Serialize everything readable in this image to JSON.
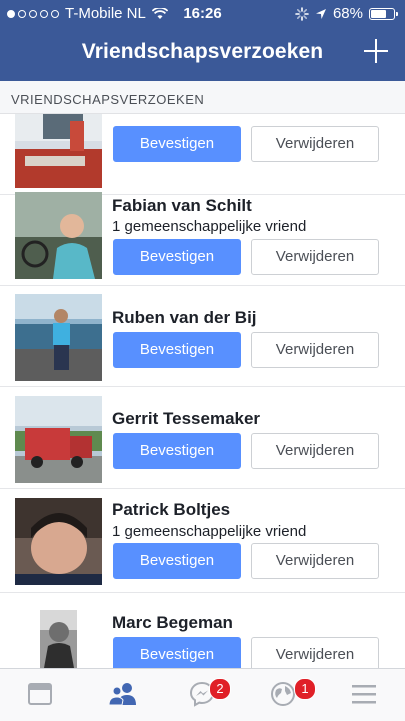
{
  "status_bar": {
    "carrier": "T-Mobile NL",
    "time": "16:26",
    "battery": "68%",
    "battery_level": 0.68,
    "icons": [
      "wifi-icon",
      "activity-spinner-icon",
      "location-arrow-icon",
      "battery-icon"
    ]
  },
  "header": {
    "title": "Vriendschapsverzoeken",
    "action_icon": "plus-icon"
  },
  "section": {
    "label": "VRIENDSCHAPSVERZOEKEN"
  },
  "requests": [
    {
      "name": "",
      "mutual": "",
      "confirm": "Bevestigen",
      "delete": "Verwijderen"
    },
    {
      "name": "Fabian van Schilt",
      "mutual": "1 gemeenschappelijke vriend",
      "confirm": "Bevestigen",
      "delete": "Verwijderen"
    },
    {
      "name": "Ruben van der Bij",
      "mutual": "",
      "confirm": "Bevestigen",
      "delete": "Verwijderen"
    },
    {
      "name": "Gerrit Tessemaker",
      "mutual": "",
      "confirm": "Bevestigen",
      "delete": "Verwijderen"
    },
    {
      "name": "Patrick Boltjes",
      "mutual": "1 gemeenschappelijke vriend",
      "confirm": "Bevestigen",
      "delete": "Verwijderen"
    },
    {
      "name": "Marc Begeman",
      "mutual": "",
      "confirm": "Bevestigen",
      "delete": "Verwijderen"
    }
  ],
  "tabbar": {
    "tabs": [
      {
        "icon": "news-feed-icon",
        "badge": ""
      },
      {
        "icon": "friend-requests-icon",
        "badge": ""
      },
      {
        "icon": "messenger-icon",
        "badge": "2"
      },
      {
        "icon": "notifications-globe-icon",
        "badge": "1"
      },
      {
        "icon": "menu-icon",
        "badge": ""
      }
    ]
  },
  "colors": {
    "brand": "#3b5998",
    "confirm_button": "#5890ff",
    "active_tab": "#4267b2",
    "badge": "#e02027"
  }
}
